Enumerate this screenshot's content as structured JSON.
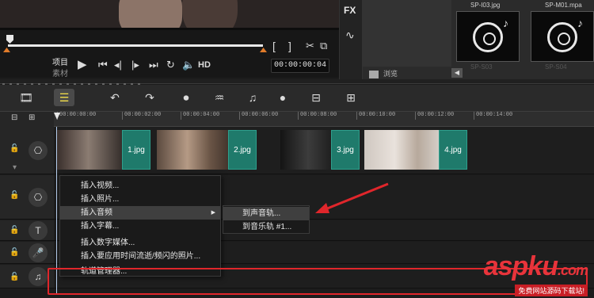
{
  "preview": {
    "mode_project": "项目",
    "mode_clip": "素材",
    "hd_label": "HD",
    "timecode": "00:00:00:04",
    "fx_label": "FX"
  },
  "library": {
    "thumbs": [
      {
        "name": "SP-I03.jpg",
        "sub": "SP-S03"
      },
      {
        "name": "SP-M01.mpa",
        "sub": "SP-S04"
      }
    ],
    "browse_label": "浏览"
  },
  "ruler": {
    "ticks": [
      "00:00:00:00",
      "00:00:02:00",
      "00:00:04:00",
      "00:00:06:00",
      "00:00:08:00",
      "00:00:10:00",
      "00:00:12:00",
      "00:00:14:00"
    ]
  },
  "clips": [
    {
      "label": "1.jpg"
    },
    {
      "label": "2.jpg"
    },
    {
      "label": "3.jpg"
    },
    {
      "label": "4.jpg"
    }
  ],
  "context_menu": {
    "items": [
      "插入视频...",
      "插入照片...",
      "插入音频",
      "插入字幕...",
      "插入数字媒体...",
      "插入要应用时间流逝/频闪的照片...",
      "轨道管理器..."
    ],
    "highlighted_index": 2
  },
  "sub_menu": {
    "items": [
      "到声音轨...",
      "到音乐轨 #1..."
    ]
  },
  "watermark": {
    "brand": "aspku",
    "domain": ".com",
    "tagline": "免费网站源码下载站!"
  },
  "colors": {
    "clip_label_bg": "#1f7a6b",
    "annotation_red": "#e0262b",
    "accent_orange": "#e07b2a"
  }
}
